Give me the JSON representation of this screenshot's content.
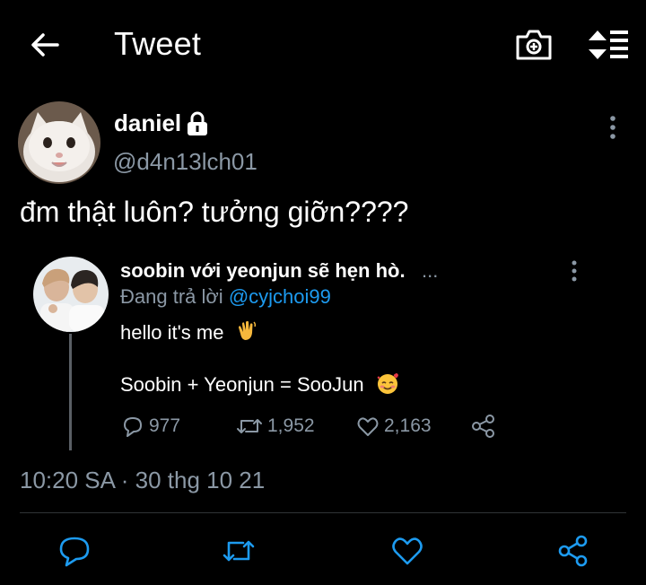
{
  "header": {
    "title": "Tweet",
    "back_icon": "arrow-left-icon",
    "camera_icon": "camera-icon",
    "sort_icon": "sort-icon"
  },
  "tweet": {
    "author_name": "daniel",
    "author_handle": "@d4n13lch01",
    "protected_icon": "lock-icon",
    "text": "đm thật luôn? tưởng giỡn????",
    "timestamp": "10:20 SA · 30 thg 10 21"
  },
  "quoted": {
    "author_name": "soobin với yeonjun sẽ hẹn hò.",
    "ellipsis": "...",
    "reply_prefix": "Đang trả lời ",
    "reply_mention": "@cyjchoi99",
    "line1": "hello it's me",
    "line2": "Soobin + Yeonjun = SooJun",
    "stats": {
      "replies": "977",
      "retweets": "1,952",
      "likes": "2,163"
    }
  },
  "colors": {
    "background": "#000000",
    "text": "#ffffff",
    "secondary_text": "#8b98a5",
    "mention": "#1d9bf0",
    "divider": "#2f3336"
  }
}
